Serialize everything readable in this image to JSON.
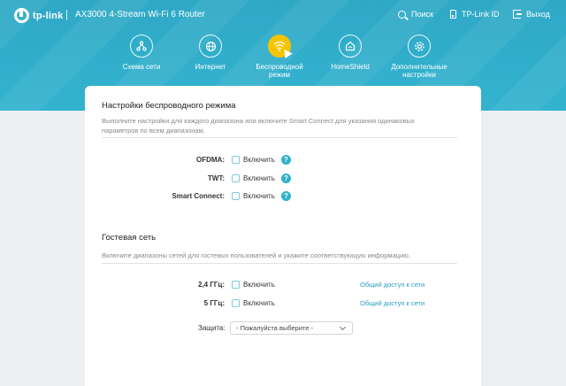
{
  "topbar": {
    "logo_text": "tp-link",
    "product": "AX3000 4-Stream Wi-Fi 6 Router",
    "search_label": "Поиск",
    "tplink_id_label": "TP-Link ID",
    "logout_label": "Выход"
  },
  "nav": {
    "items": [
      {
        "label": "Схема сети",
        "icon": "network-map-icon"
      },
      {
        "label": "Интернет",
        "icon": "globe-icon"
      },
      {
        "label_line1": "Беспроводной",
        "label_line2": "режим",
        "icon": "wifi-icon",
        "active": true
      },
      {
        "label": "HomeShield",
        "icon": "home-shield-icon"
      },
      {
        "label_line1": "Дополнительные",
        "label_line2": "настройки",
        "icon": "gear-icon"
      }
    ]
  },
  "wireless": {
    "title": "Настройки беспроводного режима",
    "desc_line1": "Выполните настройки для каждого диапазона или включите Smart Connect для указания одинаковых",
    "desc_line2": "параметров по всем диапазонам.",
    "rows": [
      {
        "label": "OFDMA:",
        "check_label": "Включить",
        "checked": false
      },
      {
        "label": "TWT:",
        "check_label": "Включить",
        "checked": false
      },
      {
        "label": "Smart Connect:",
        "check_label": "Включить",
        "checked": false
      }
    ]
  },
  "guest": {
    "title": "Гостевая сеть",
    "desc": "Включите диапазоны сетей для гостевых пользователей и укажите соответствующую информацию.",
    "rows": [
      {
        "label": "2,4 ГГц:",
        "check_label": "Включить",
        "link": "Общий доступ к сети",
        "checked": false
      },
      {
        "label": "5 ГГц:",
        "check_label": "Включить",
        "link": "Общий доступ к сети",
        "checked": false
      }
    ],
    "security_label": "Защита:",
    "security_value": "- Пожалуйста выберите -"
  },
  "colors": {
    "header": "#33b3cf",
    "active_nav": "#f5c400",
    "link": "#2a9fc4"
  }
}
